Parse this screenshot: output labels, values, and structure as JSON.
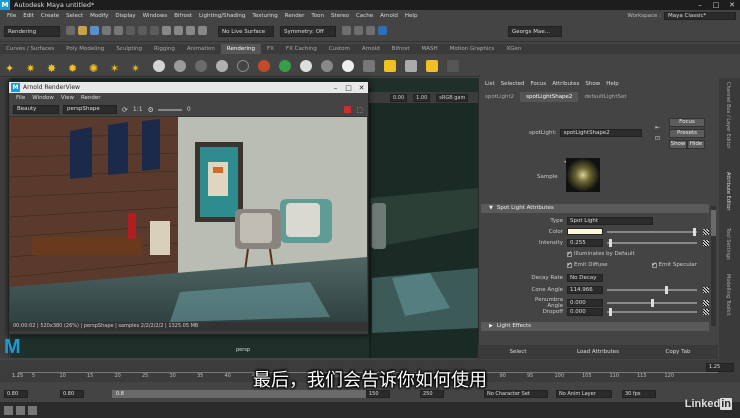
{
  "window": {
    "title": "Autodesk Maya  untitled*",
    "controls": [
      "–",
      "□",
      "✕"
    ]
  },
  "menu": [
    "File",
    "Edit",
    "Create",
    "Select",
    "Modify",
    "Display",
    "Windows",
    "Bifrost",
    "Lighting/Shading",
    "Texturing",
    "Render",
    "Toon",
    "Stereo",
    "Cache",
    "Arnold",
    "Help"
  ],
  "workspace": {
    "label": "Workspace :",
    "value": "Maya Classic*"
  },
  "status": {
    "mode": "Rendering",
    "live_surface": "No Live Surface",
    "symmetry": "Symmetry: Off",
    "user": "Georgs Mae..."
  },
  "shelf_tabs": [
    "Curves / Surfaces",
    "Poly Modeling",
    "Sculpting",
    "Rigging",
    "Animation",
    "Rendering",
    "FX",
    "FX Caching",
    "Custom",
    "Arnold",
    "Bifrost",
    "MASH",
    "Motion Graphics",
    "XGen"
  ],
  "shelf_active_tab": "Rendering",
  "viewport": {
    "camera_label": "persp",
    "toolbar": {
      "value_a": "0.00",
      "value_b": "1.00",
      "color_space": "sRGB gam"
    }
  },
  "render_view": {
    "title": "Arnold RenderView",
    "menu": [
      "File",
      "Window",
      "View",
      "Render"
    ],
    "aov": "Beauty",
    "camera": "perspShape",
    "ratio": "1:1",
    "exposure": "0",
    "status": "00:00:02 | 520x380 (26%) | perspShape | samples 2/2/2/2/2 | 1325.05 MB"
  },
  "attribute_editor": {
    "menu": [
      "List",
      "Selected",
      "Focus",
      "Attributes",
      "Show",
      "Help"
    ],
    "tabs": [
      "spotLight2",
      "spotLightShape2",
      "defaultLightSet"
    ],
    "active_tab": "spotLightShape2",
    "node_label": "spotLight:",
    "node_name": "spotLightShape2",
    "buttons": {
      "focus": "Focus",
      "presets": "Presets",
      "show": "Show",
      "hide": "Hide"
    },
    "sample_label": "Sample",
    "section": "Spot Light Attributes",
    "type_label": "Type",
    "type_value": "Spot Light",
    "color_label": "Color",
    "intensity_label": "Intensity",
    "intensity_value": "0.255",
    "illuminates_default": "Illuminates by Default",
    "emit_diffuse": "Emit Diffuse",
    "emit_specular": "Emit Specular",
    "decay_label": "Decay Rate",
    "decay_value": "No Decay",
    "cone_label": "Cone Angle",
    "cone_value": "114.966",
    "penumbra_label": "Penumbra Angle",
    "penumbra_value": "0.000",
    "dropoff_label": "Dropoff",
    "dropoff_value": "0.000",
    "light_effects": "Light Effects",
    "bottom_buttons": [
      "Select",
      "Load Attributes",
      "Copy Tab"
    ],
    "light_color": "#fff8d8"
  },
  "side_tabs": [
    "Channel Box / Layer Editor",
    "Attribute Editor",
    "Tool Settings",
    "Modelling Toolkit"
  ],
  "timeline": {
    "ticks": [
      "5",
      "10",
      "15",
      "20",
      "25",
      "30",
      "35",
      "40",
      "45",
      "50",
      "55",
      "60",
      "65",
      "70",
      "75",
      "80",
      "85",
      "90",
      "95",
      "100",
      "105",
      "110",
      "115",
      "120"
    ],
    "current_frame": "1.25"
  },
  "range": {
    "start": "0.80",
    "start2": "0.80",
    "range_start": "0.8",
    "range_end": "150",
    "end": "150",
    "end2": "250",
    "character_set": "No Character Set",
    "anim_layer": "No Anim Layer",
    "fps": "30 fps"
  },
  "subtitle": "最后，我们会告诉你如何使用",
  "watermark": "Linked"
}
